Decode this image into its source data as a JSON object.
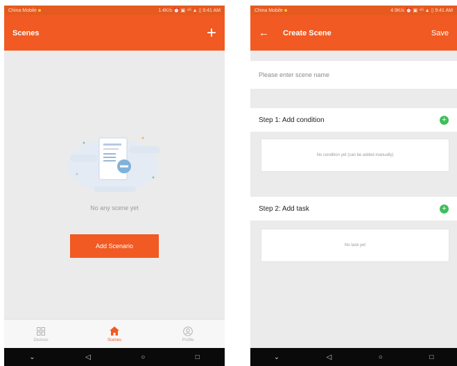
{
  "left": {
    "status": {
      "carrier": "China Mobile",
      "right": "1.4K/s ⏰ ▣ ⁴ᴳ ▲ ▯ 9:41 AM"
    },
    "appbar": {
      "title": "Scenes",
      "add_icon": "plus-icon"
    },
    "empty_text": "No any scene yet",
    "add_button": "Add Scenario",
    "nav": [
      {
        "label": "Devices",
        "icon": "grid-icon"
      },
      {
        "label": "Scenes",
        "icon": "home-icon"
      },
      {
        "label": "Profile",
        "icon": "profile-icon"
      }
    ],
    "sysnav": [
      "⌄",
      "◁",
      "○",
      "□"
    ]
  },
  "right": {
    "status": {
      "carrier": "China Mobile",
      "right": "4.9K/s ⏰ ▣ ⁴ᴳ ▲ ▯ 9:41 AM"
    },
    "appbar": {
      "back": "←",
      "title": "Create Scene",
      "save": "Save"
    },
    "name_placeholder": "Please enter scene name",
    "step1": {
      "title": "Step 1: Add condition",
      "empty": "No condition yet (can be added manually)"
    },
    "step2": {
      "title": "Step 2: Add task",
      "empty": "No task yet"
    },
    "sysnav": [
      "⌄",
      "◁",
      "○",
      "□"
    ]
  },
  "colors": {
    "accent": "#f15a22",
    "green": "#3fbf5b",
    "bg": "#ebebeb"
  }
}
